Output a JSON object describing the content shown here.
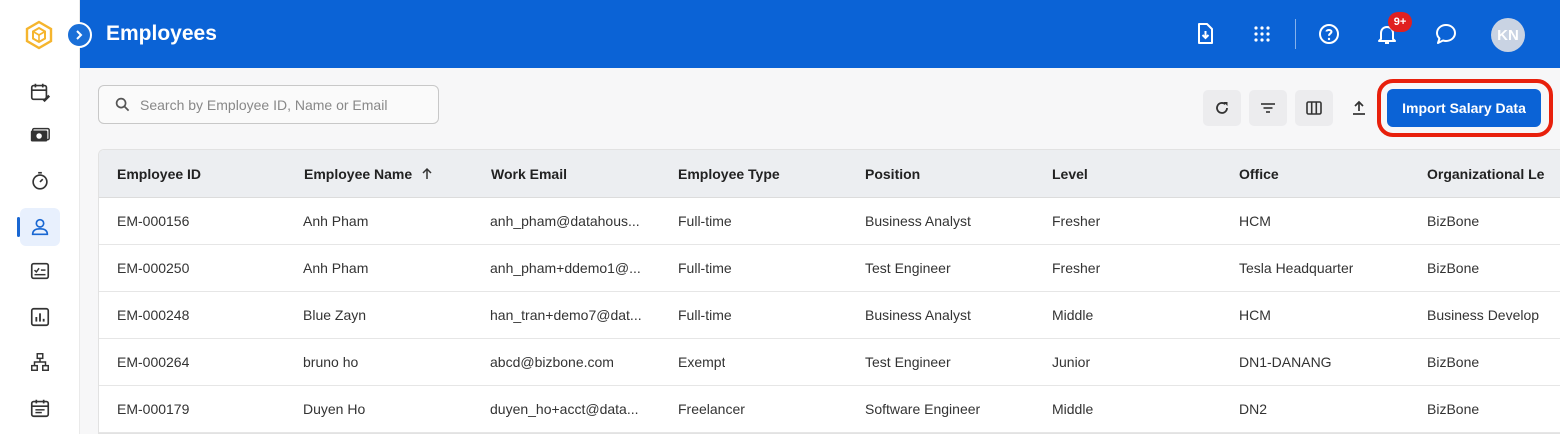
{
  "header": {
    "title": "Employees",
    "notification_badge": "9+",
    "avatar_initials": "KN",
    "brand_color": "#0b63d6"
  },
  "sidebar": {
    "items": [
      {
        "icon": "calendar-edit-icon"
      },
      {
        "icon": "payroll-icon"
      },
      {
        "icon": "timer-icon"
      },
      {
        "icon": "user-icon",
        "active": true
      },
      {
        "icon": "checklist-icon"
      },
      {
        "icon": "report-chart-icon"
      },
      {
        "icon": "org-chart-icon"
      },
      {
        "icon": "calendar-icon"
      }
    ]
  },
  "toolbar": {
    "search_placeholder": "Search by Employee ID, Name or Email",
    "import_label": "Import Salary Data",
    "highlight_color": "#e8200c"
  },
  "table": {
    "columns": [
      "Employee ID",
      "Employee Name",
      "Work Email",
      "Employee Type",
      "Position",
      "Level",
      "Office",
      "Organizational Le"
    ],
    "rows": [
      [
        "EM-000156",
        "Anh Pham",
        "anh_pham@datahous...",
        "Full-time",
        "Business Analyst",
        "Fresher",
        "HCM",
        "BizBone"
      ],
      [
        "EM-000250",
        "Anh Pham",
        "anh_pham+ddemo1@...",
        "Full-time",
        "Test Engineer",
        "Fresher",
        "Tesla Headquarter",
        "BizBone"
      ],
      [
        "EM-000248",
        "Blue Zayn",
        "han_tran+demo7@dat...",
        "Full-time",
        "Business Analyst",
        "Middle",
        "HCM",
        "Business Develop"
      ],
      [
        "EM-000264",
        "bruno ho",
        "abcd@bizbone.com",
        "Exempt",
        "Test Engineer",
        "Junior",
        "DN1-DANANG",
        "BizBone"
      ],
      [
        "EM-000179",
        "Duyen Ho",
        "duyen_ho+acct@data...",
        "Freelancer",
        "Software Engineer",
        "Middle",
        "DN2",
        "BizBone"
      ]
    ]
  }
}
